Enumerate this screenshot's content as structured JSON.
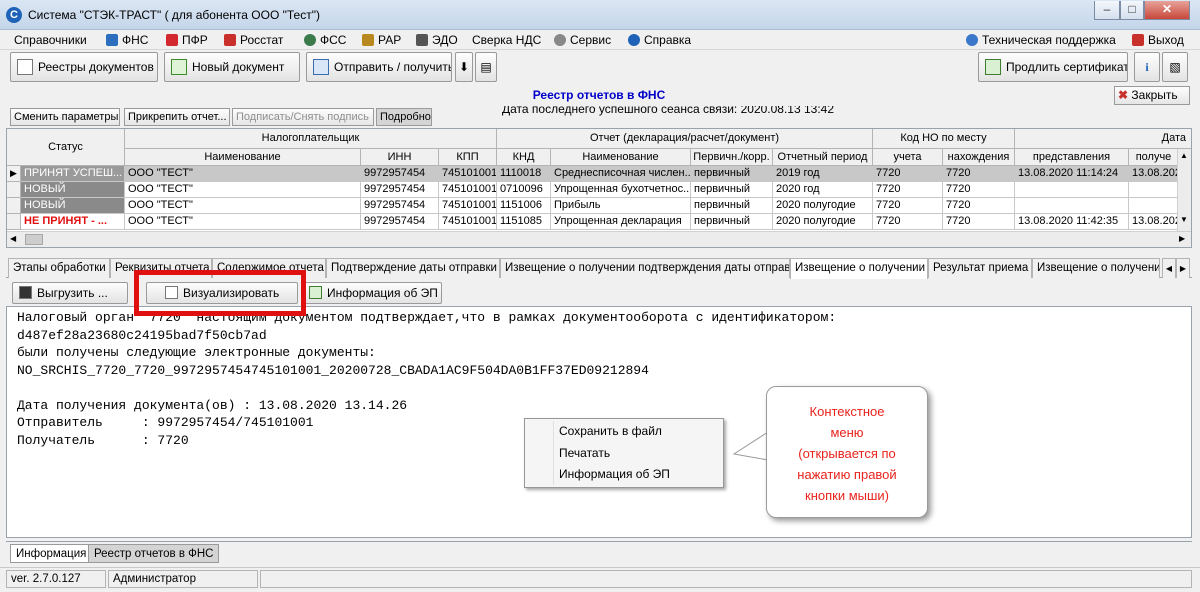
{
  "window": {
    "title": "Система \"СТЭК-ТРАСТ\" ( для абонента ООО \"Тест\")"
  },
  "menu": [
    {
      "label": "Справочники",
      "icon": ""
    },
    {
      "label": "ФНС",
      "icon": "fns-icon"
    },
    {
      "label": "ПФР",
      "icon": "pfr-icon"
    },
    {
      "label": "Росстат",
      "icon": "rosstat-icon"
    },
    {
      "label": "ФСС",
      "icon": "fss-icon"
    },
    {
      "label": "РАР",
      "icon": "rar-icon"
    },
    {
      "label": "ЭДО",
      "icon": "edo-icon"
    },
    {
      "label": "Сверка НДС",
      "icon": ""
    },
    {
      "label": "Сервис",
      "icon": "gear-icon"
    },
    {
      "label": "Справка",
      "icon": "help-icon"
    },
    {
      "label": "Техническая поддержка",
      "icon": "globe-icon"
    },
    {
      "label": "Выход",
      "icon": "exit-icon"
    }
  ],
  "toolbar": {
    "registries": "Реестры документов",
    "new_doc": "Новый документ",
    "send_receive": "Отправить / получить",
    "last_session": "Дата последнего успешного сеанса связи: 2020.08.13 13:42",
    "extend_cert": "Продлить сертификат"
  },
  "panel": {
    "title": "Реестр отчетов в ФНС",
    "close": "Закрыть",
    "actions": [
      "Сменить параметры",
      "Прикрепить отчет...",
      "Подписать/Снять подпись",
      "Подробно"
    ]
  },
  "grid": {
    "group_headers": [
      "Статус",
      "Налогоплательщик",
      "Отчет (декларация/расчет/документ)",
      "Код НО по месту",
      "Дата"
    ],
    "headers": [
      "Наименование",
      "ИНН",
      "КПП",
      "КНД",
      "Наименование",
      "Первичн./корр.",
      "Отчетный период",
      "учета",
      "нахождения",
      "представления",
      "получе"
    ],
    "rows": [
      {
        "status": "ПРИНЯТ УСПЕШ...",
        "name": "ООО \"ТЕСТ\"",
        "inn": "9972957454",
        "kpp": "745101001",
        "knd": "1110018",
        "rname": "Среднесписочная числен...",
        "kind": "первичный",
        "period": "2019 год",
        "uch": "7720",
        "nah": "7720",
        "pred": "13.08.2020 11:14:24",
        "pol": "13.08.202"
      },
      {
        "status": "НОВЫЙ",
        "name": "ООО \"ТЕСТ\"",
        "inn": "9972957454",
        "kpp": "745101001",
        "knd": "0710096",
        "rname": "Упрощенная бухотчетнос...",
        "kind": "первичный",
        "period": "2020 год",
        "uch": "7720",
        "nah": "7720",
        "pred": "",
        "pol": ""
      },
      {
        "status": "НОВЫЙ",
        "name": "ООО \"ТЕСТ\"",
        "inn": "9972957454",
        "kpp": "745101001",
        "knd": "1151006",
        "rname": "Прибыль",
        "kind": "первичный",
        "period": "2020 полугодие",
        "uch": "7720",
        "nah": "7720",
        "pred": "",
        "pol": ""
      },
      {
        "status": "НЕ ПРИНЯТ - ...",
        "name": "ООО \"ТЕСТ\"",
        "inn": "9972957454",
        "kpp": "745101001",
        "knd": "1151085",
        "rname": "Упрощенная декларация",
        "kind": "первичный",
        "period": "2020 полугодие",
        "uch": "7720",
        "nah": "7720",
        "pred": "13.08.2020 11:42:35",
        "pol": "13.08.202"
      }
    ]
  },
  "tabs": [
    "Этапы обработки",
    "Реквизиты отчета",
    "Содержимое отчета",
    "Подтверждение даты отправки",
    "Извещение о получении подтверждения даты отправки",
    "Извещение о получении",
    "Результат приема",
    "Извещение о получени"
  ],
  "doc_buttons": {
    "export": "Выгрузить ...",
    "visualize": "Визуализировать",
    "ep_info": "Информация об ЭП"
  },
  "text_lines": [
    "Налоговый орган \"7720\" настоящим документом подтверждает,что в рамках документооборота с идентификатором:",
    "d487ef28a23680c24195bad7f50cb7ad",
    "были получены следующие электронные документы:",
    "NO_SRCHIS_7720_7720_9972957454745101001_20200728_CBADA1AC9F504DA0B1FF37ED09212894",
    "",
    "Дата получения документа(ов) : 13.08.2020 13.14.26",
    "Отправитель     : 9972957454/745101001",
    "Получатель      : 7720"
  ],
  "context_menu": [
    "Сохранить в файл",
    "Печатать",
    "Информация об ЭП"
  ],
  "callout": [
    "Контекстное",
    "меню",
    "(открывается по",
    "нажатию правой",
    "кнопки мыши)"
  ],
  "bottom_tabs": [
    "Информация",
    "Реестр отчетов в ФНС"
  ],
  "status": {
    "version": "ver. 2.7.0.127",
    "user": "Администратор"
  },
  "colors": {
    "accent_title": "#0000c8",
    "alert_red": "#e8231c",
    "selected_row": "#c8c8c8"
  }
}
